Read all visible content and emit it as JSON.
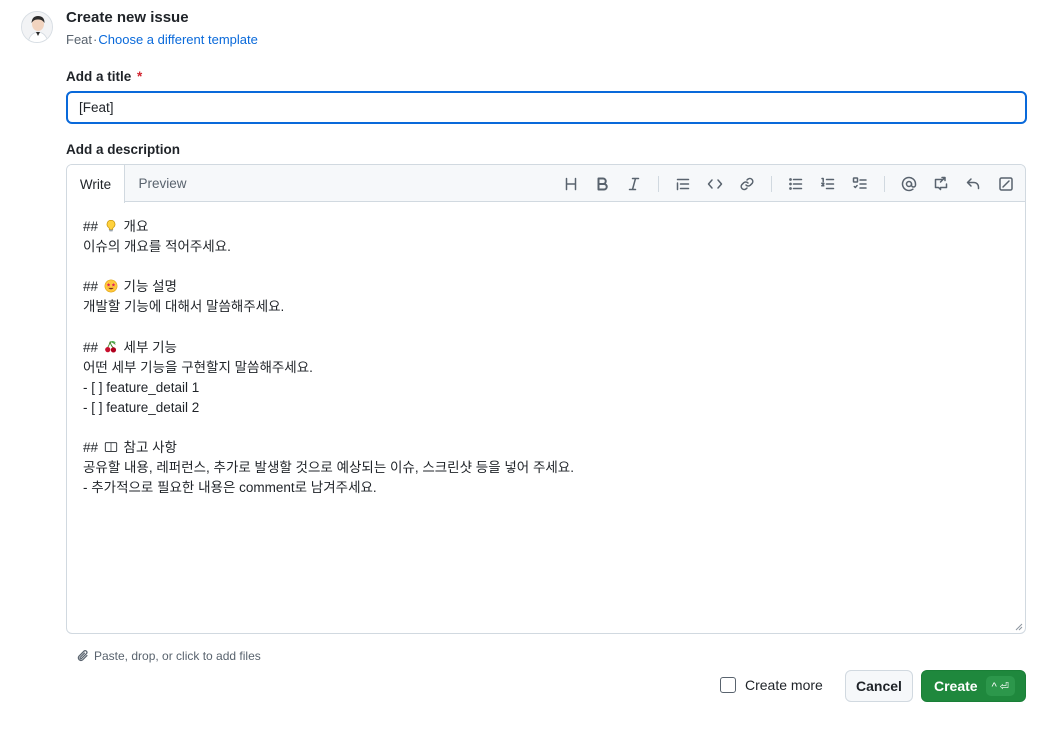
{
  "header": {
    "title": "Create new issue",
    "template_name": "Feat",
    "separator": "·",
    "change_template_link": "Choose a different template"
  },
  "title_field": {
    "label": "Add a title",
    "required_mark": "*",
    "value": "[Feat]"
  },
  "description": {
    "label": "Add a description",
    "tabs": [
      {
        "label": "Write",
        "active": true
      },
      {
        "label": "Preview",
        "active": false
      }
    ],
    "toolbar_icons": [
      "heading-icon",
      "bold-icon",
      "italic-icon",
      "quote-icon",
      "code-icon",
      "link-icon",
      "unordered-list-icon",
      "ordered-list-icon",
      "task-list-icon",
      "mention-icon",
      "reference-icon",
      "saved-replies-icon",
      "fullscreen-icon"
    ],
    "lines": [
      {
        "prefix": "## ",
        "emoji": "lightbulb",
        "text": "개요"
      },
      {
        "text": "이슈의 개요를 적어주세요."
      },
      {
        "text": ""
      },
      {
        "prefix": "## ",
        "emoji": "star-struck-face",
        "text": "기능 설명"
      },
      {
        "text": "개발할 기능에 대해서 말씀해주세요."
      },
      {
        "text": ""
      },
      {
        "prefix": "## ",
        "emoji": "cherries",
        "text": "세부 기능"
      },
      {
        "text": "어떤 세부 기능을 구현할지 말씀해주세요."
      },
      {
        "text": "- [ ] feature_detail 1"
      },
      {
        "text": "- [ ] feature_detail 2"
      },
      {
        "text": ""
      },
      {
        "prefix": "## ",
        "emoji": "book",
        "text": "참고 사항"
      },
      {
        "text": "공유할 내용, 레퍼런스, 추가로 발생할 것으로 예상되는 이슈, 스크린샷 등을 넣어 주세요."
      },
      {
        "text": "- 추가적으로 필요한 내용은 comment로 남겨주세요."
      }
    ]
  },
  "attach_hint": "Paste, drop, or click to add files",
  "footer": {
    "create_more_label": "Create more",
    "create_more_checked": false,
    "cancel_label": "Cancel",
    "create_label": "Create",
    "create_shortcut": "^ ⏎"
  },
  "colors": {
    "primary_green": "#1f883d",
    "link_blue": "#0969da",
    "focus_border": "#0969da",
    "required_red": "#d1242f"
  }
}
